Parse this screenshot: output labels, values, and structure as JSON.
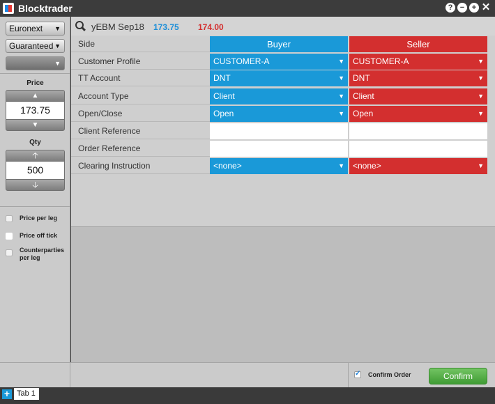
{
  "window": {
    "title": "Blocktrader",
    "controls": [
      "?",
      "−",
      "+",
      "✕"
    ]
  },
  "left_panel": {
    "exchange": "Euronext",
    "order_type": "Guaranteed",
    "third_select": "",
    "price_label": "Price",
    "price_value": "173.75",
    "qty_label": "Qty",
    "qty_value": "500",
    "checkboxes": [
      "Price per leg",
      "Price off tick",
      "Counterparties per leg"
    ]
  },
  "instrument": {
    "name": "yEBM Sep18",
    "bid": "173.75",
    "ask": "174.00"
  },
  "grid": {
    "labels": [
      "Side",
      "Customer Profile",
      "TT Account",
      "Account Type",
      "Open/Close",
      "Client Reference",
      "Order Reference",
      "Clearing Instruction"
    ],
    "buyer": [
      "Buyer",
      "CUSTOMER-A",
      "DNT",
      "Client",
      "Open",
      "",
      "",
      "<none>"
    ],
    "seller": [
      "Seller",
      "CUSTOMER-A",
      "DNT",
      "Client",
      "Open",
      "",
      "",
      "<none>"
    ]
  },
  "footer": {
    "confirm_order_label": "Confirm Order",
    "confirm_order_checked": true,
    "confirm_button": "Confirm"
  },
  "tabs": {
    "add": "+",
    "items": [
      "Tab  1"
    ]
  },
  "colors": {
    "buyer": "#1a99d8",
    "seller": "#d32f2f",
    "confirm": "#4caf50",
    "titlebar": "#3c3c3c"
  }
}
